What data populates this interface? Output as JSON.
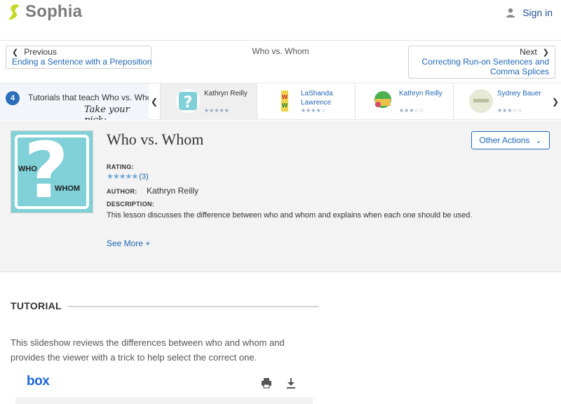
{
  "header": {
    "brand": "Sophia",
    "signin_label": "Sign in"
  },
  "nav": {
    "prev_dir": "Previous",
    "prev_title": "Ending a Sentence with a Preposition",
    "current_title": "Who vs. Whom",
    "next_dir": "Next",
    "next_title_line1": "Correcting Run-on Sentences and",
    "next_title_line2": "Comma Splices"
  },
  "tutorials_bar": {
    "count": "4",
    "intro": "Tutorials that teach Who vs. Whom",
    "pick": "Take your pick:",
    "cards": [
      {
        "name": "Kathryn Reilly",
        "stars": "★★★★★",
        "rating": 4.5,
        "active": true
      },
      {
        "name": "LaShanda Lawrence",
        "stars": "★★★★☆",
        "rating": 4,
        "active": false
      },
      {
        "name": "Kathryn Reilly",
        "stars": "★★★☆☆",
        "rating": 3,
        "active": false
      },
      {
        "name": "Sydney Bauer",
        "stars": "★★★☆☆",
        "rating": 3,
        "active": false
      }
    ]
  },
  "lesson": {
    "title": "Who vs. Whom",
    "thumb_who": "WHO",
    "thumb_whom": "WHOM",
    "other_actions": "Other Actions",
    "rating_label": "RATING:",
    "rating_stars": "★★★★★",
    "rating_count": "(3)",
    "author_label": "AUTHOR:",
    "author": "Kathryn Reilly",
    "description_label": "DESCRIPTION:",
    "description": "This lesson discusses the difference between who and whom and explains when each one should be used.",
    "see_more": "See More +"
  },
  "tutorial": {
    "heading": "TUTORIAL",
    "description": "This slideshow reviews the differences between who and whom and provides the viewer with a trick to help select the correct one.",
    "viewer_brand": "box"
  },
  "colors": {
    "link": "#1f66b5",
    "brand_green": "#c6d92b",
    "teal": "#7fd0d7"
  }
}
